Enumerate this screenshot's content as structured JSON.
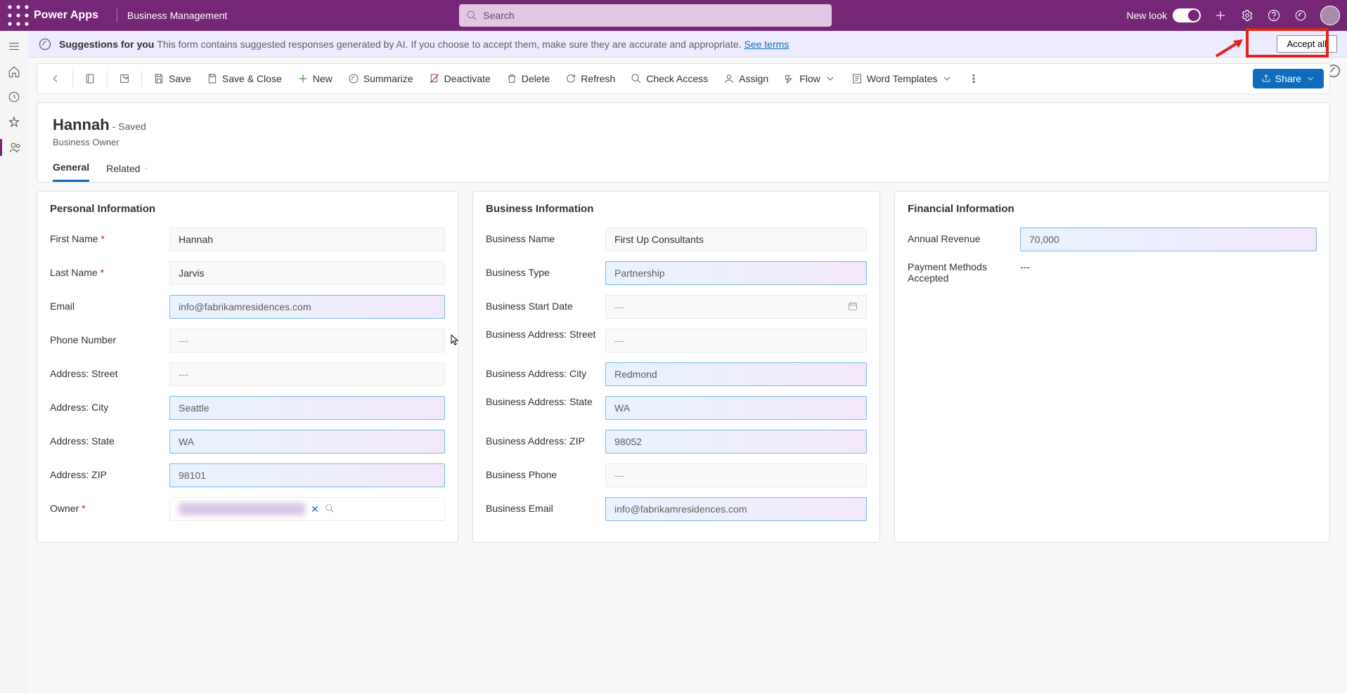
{
  "topbar": {
    "app": "Power Apps",
    "area": "Business Management",
    "search_placeholder": "Search",
    "new_look": "New look"
  },
  "suggestions": {
    "title": "Suggestions for you",
    "text": "This form contains suggested responses generated by AI. If you choose to accept them, make sure they are accurate and appropriate.",
    "link": "See terms",
    "accept_all": "Accept all"
  },
  "cmdbar": {
    "save": "Save",
    "save_close": "Save & Close",
    "new": "New",
    "summarize": "Summarize",
    "deactivate": "Deactivate",
    "delete": "Delete",
    "refresh": "Refresh",
    "check_access": "Check Access",
    "assign": "Assign",
    "flow": "Flow",
    "word_templates": "Word Templates",
    "share": "Share"
  },
  "record": {
    "title": "Hannah",
    "saved": "- Saved",
    "subtitle": "Business Owner"
  },
  "tabs": {
    "general": "General",
    "related": "Related"
  },
  "sections": {
    "personal": "Personal Information",
    "business": "Business Information",
    "financial": "Financial Information"
  },
  "labels": {
    "first_name": "First Name",
    "last_name": "Last Name",
    "email": "Email",
    "phone": "Phone Number",
    "addr_street": "Address: Street",
    "addr_city": "Address: City",
    "addr_state": "Address: State",
    "addr_zip": "Address: ZIP",
    "owner": "Owner",
    "biz_name": "Business Name",
    "biz_type": "Business Type",
    "biz_start": "Business Start Date",
    "biz_street": "Business Address: Street",
    "biz_city": "Business Address: City",
    "biz_state": "Business Address: State",
    "biz_zip": "Business Address: ZIP",
    "biz_phone": "Business Phone",
    "biz_email": "Business Email",
    "revenue": "Annual Revenue",
    "pay_methods": "Payment Methods Accepted"
  },
  "values": {
    "first_name": "Hannah",
    "last_name": "Jarvis",
    "email": "info@fabrikamresidences.com",
    "phone": "---",
    "addr_street": "---",
    "addr_city": "Seattle",
    "addr_state": "WA",
    "addr_zip": "98101",
    "biz_name": "First Up Consultants",
    "biz_type": "Partnership",
    "biz_start": "---",
    "biz_street": "---",
    "biz_city": "Redmond",
    "biz_state": "WA",
    "biz_zip": "98052",
    "biz_phone": "---",
    "biz_email": "info@fabrikamresidences.com",
    "revenue": "70,000",
    "pay_methods": "---"
  }
}
